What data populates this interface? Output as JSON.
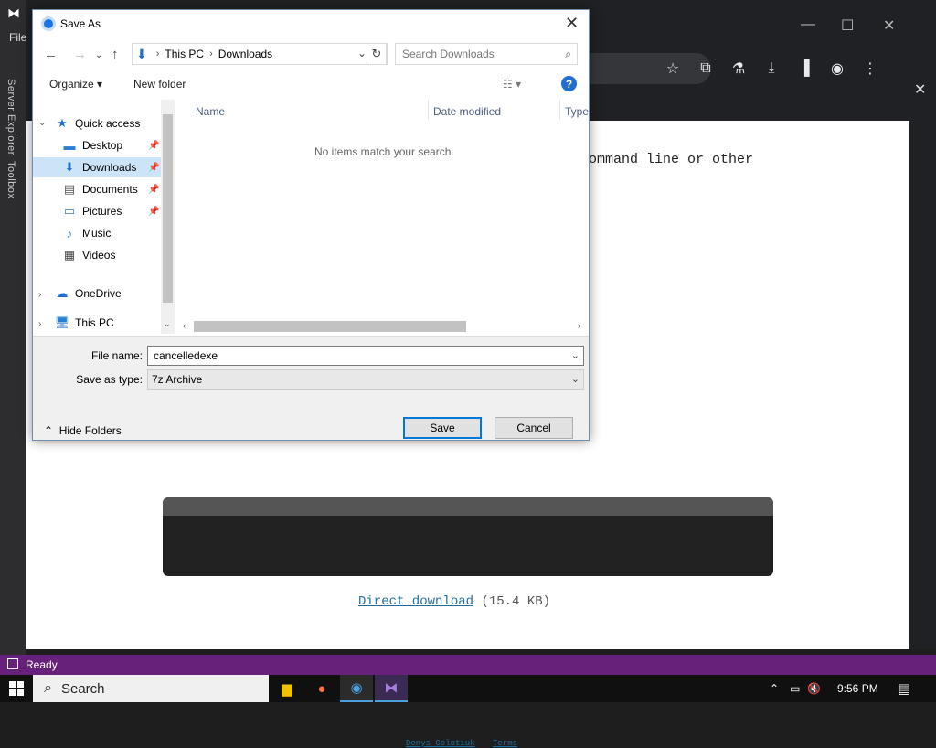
{
  "vs": {
    "file_menu": "File",
    "side_tabs": [
      "Server Explorer",
      "Toolbox"
    ],
    "status": "Ready"
  },
  "browser": {
    "page_text": "ommand line or other",
    "download_link": "Direct download",
    "download_size": "(15.4 KB)",
    "footer_links": [
      "Denys Golotiuk",
      "Terms"
    ]
  },
  "dialog": {
    "title": "Save As",
    "breadcrumb": [
      "This PC",
      "Downloads"
    ],
    "search_placeholder": "Search Downloads",
    "organize": "Organize",
    "new_folder": "New folder",
    "nav_items": [
      {
        "label": "Quick access",
        "icon": "star-icon"
      },
      {
        "label": "Desktop",
        "icon": "desktop-icon",
        "pinned": true
      },
      {
        "label": "Downloads",
        "icon": "download-icon",
        "pinned": true,
        "selected": true
      },
      {
        "label": "Documents",
        "icon": "document-icon",
        "pinned": true
      },
      {
        "label": "Pictures",
        "icon": "picture-icon",
        "pinned": true
      },
      {
        "label": "Music",
        "icon": "music-icon"
      },
      {
        "label": "Videos",
        "icon": "video-icon"
      },
      {
        "label": "OneDrive",
        "icon": "cloud-icon"
      },
      {
        "label": "This PC",
        "icon": "computer-icon"
      }
    ],
    "columns": [
      "Name",
      "Date modified",
      "Type"
    ],
    "empty_message": "No items match your search.",
    "file_name_label": "File name:",
    "file_name_value": "cancelledexe",
    "save_type_label": "Save as type:",
    "save_type_value": "7z Archive",
    "hide_folders": "Hide Folders",
    "save_button": "Save",
    "cancel_button": "Cancel"
  },
  "taskbar": {
    "search": "Search",
    "time": "9:56 PM"
  },
  "colors": {
    "vs_status": "#68217a",
    "accent": "#0078d7",
    "selection": "#cce4f7"
  }
}
